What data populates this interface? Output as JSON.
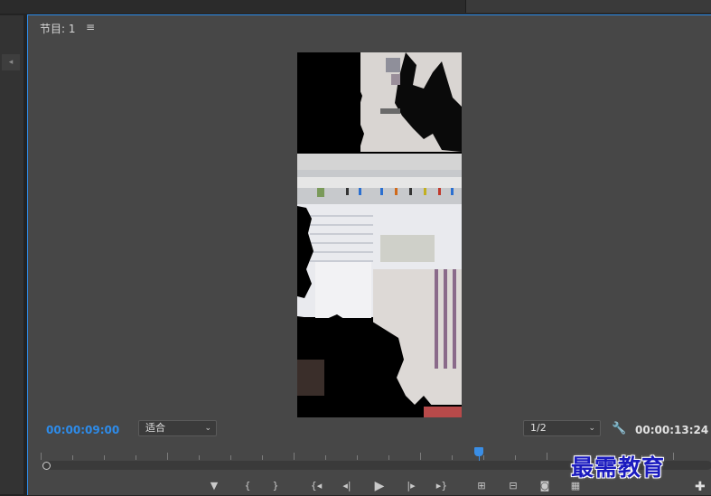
{
  "panel": {
    "title": "节目: 1",
    "menu_glyph": "≡"
  },
  "playback": {
    "current_timecode": "00:00:09:00",
    "duration_timecode": "00:00:13:24",
    "zoom_label": "适合",
    "resolution_label": "1/2",
    "playhead_progress": 0.66
  },
  "watermark": {
    "text": "最需教育"
  },
  "icons": {
    "wrench": "wrench-icon",
    "add_marker": "marker-icon",
    "mark_in": "mark-in-icon",
    "mark_out": "mark-out-icon",
    "go_to_in": "go-to-in-icon",
    "step_back": "step-back-icon",
    "play": "play-icon",
    "step_forward": "step-forward-icon",
    "go_to_out": "go-to-out-icon",
    "lift": "lift-icon",
    "extract": "extract-icon",
    "export_frame": "camera-icon",
    "compare": "compare-view-icon",
    "button_editor": "plus-icon"
  },
  "colors": {
    "accent": "#2d8ceb",
    "panel_bg": "#474747",
    "watermark": "#1b1bbf"
  }
}
